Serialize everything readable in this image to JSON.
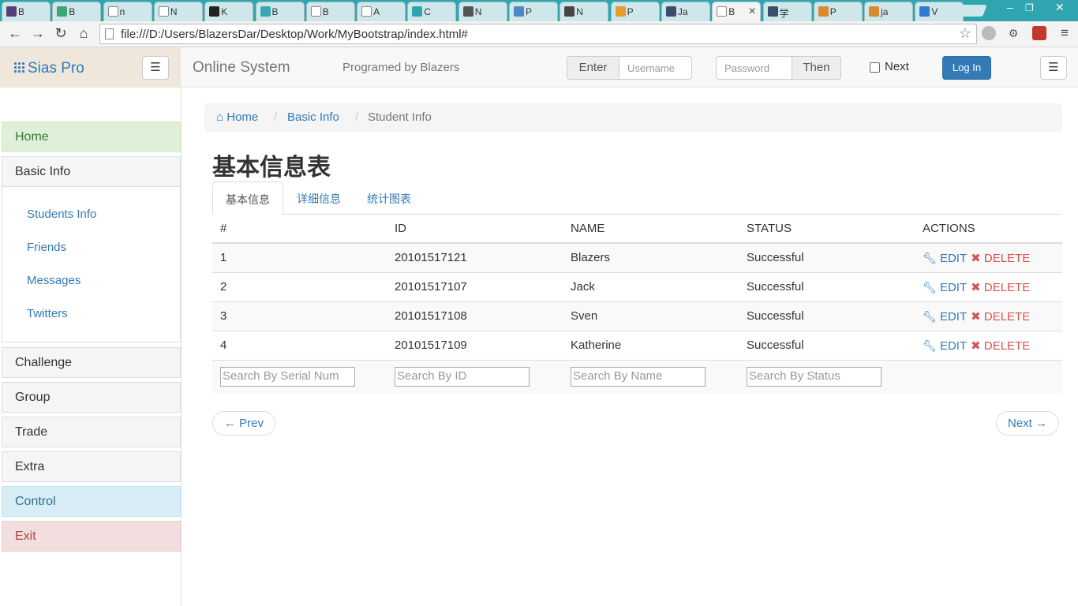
{
  "browser": {
    "tabs": [
      {
        "label": "B",
        "icon": "bootstrap-icon",
        "color": "#563d7c"
      },
      {
        "label": "B",
        "icon": "vue-icon",
        "color": "#3aa776"
      },
      {
        "label": "n",
        "icon": "page-icon",
        "color": ""
      },
      {
        "label": "N",
        "icon": "page-icon",
        "color": ""
      },
      {
        "label": "K",
        "icon": "k-icon",
        "color": "#222222"
      },
      {
        "label": "B",
        "icon": "bootstrap-icon",
        "color": "#3aa7b0"
      },
      {
        "label": "B",
        "icon": "page-icon",
        "color": ""
      },
      {
        "label": "A",
        "icon": "page-icon",
        "color": ""
      },
      {
        "label": "C",
        "icon": "chevron-icon",
        "color": "#2fa5b0"
      },
      {
        "label": "N",
        "icon": "photo-icon",
        "color": "#555555"
      },
      {
        "label": "P",
        "icon": "hexagon-icon",
        "color": "#4f86c6"
      },
      {
        "label": "N",
        "icon": "grid-icon",
        "color": "#444444"
      },
      {
        "label": "P",
        "icon": "shield-icon",
        "color": "#e89c2b"
      },
      {
        "label": "Ja",
        "icon": "bootstrap-icon",
        "color": "#3d4b6c"
      },
      {
        "label": "B",
        "icon": "page-icon",
        "color": "",
        "active": true
      },
      {
        "label": "学",
        "icon": "bootstrap-icon",
        "color": "#3d4b6c"
      },
      {
        "label": "P",
        "icon": "stack-icon",
        "color": "#d88a2e"
      },
      {
        "label": "ja",
        "icon": "stack-icon",
        "color": "#d88a2e"
      },
      {
        "label": "V",
        "icon": "code-icon",
        "color": "#2e7bcf"
      }
    ],
    "url": "file:///D:/Users/BlazersDar/Desktop/Work/MyBootstrap/index.html#"
  },
  "header": {
    "brand": "Sias Pro",
    "title": "Online System",
    "subtitle": "Programed by Blazers",
    "enter_label": "Enter",
    "username_placeholder": "Username",
    "password_placeholder": "Password",
    "then_label": "Then",
    "next_label": "Next",
    "login_label": "Log In"
  },
  "sidebar": {
    "items": [
      {
        "label": "Home",
        "style": "success"
      },
      {
        "label": "Basic Info",
        "style": "default"
      },
      {
        "label": "Challenge",
        "style": "default"
      },
      {
        "label": "Group",
        "style": "default"
      },
      {
        "label": "Trade",
        "style": "default"
      },
      {
        "label": "Extra",
        "style": "default"
      },
      {
        "label": "Control",
        "style": "info"
      },
      {
        "label": "Exit",
        "style": "danger"
      }
    ],
    "subitems": [
      "Students Info",
      "Friends",
      "Messages",
      "Twitters"
    ]
  },
  "breadcrumb": {
    "home": "Home",
    "basic": "Basic Info",
    "current": "Student Info",
    "sep": "/"
  },
  "main": {
    "title": "基本信息表",
    "tabs": [
      {
        "label": "基本信息",
        "active": true
      },
      {
        "label": "详细信息"
      },
      {
        "label": "统计图表"
      }
    ]
  },
  "table": {
    "headers": [
      "#",
      "ID",
      "NAME",
      "STATUS",
      "ACTIONS"
    ],
    "rows": [
      {
        "num": "1",
        "id": "20101517121",
        "name": "Blazers",
        "status": "Successful"
      },
      {
        "num": "2",
        "id": "20101517107",
        "name": "Jack",
        "status": "Successful"
      },
      {
        "num": "3",
        "id": "20101517108",
        "name": "Sven",
        "status": "Successful"
      },
      {
        "num": "4",
        "id": "20101517109",
        "name": "Katherine",
        "status": "Successful"
      }
    ],
    "edit_label": "EDIT",
    "delete_label": "DELETE",
    "search_placeholders": [
      "Search By Serial Num",
      "Search By ID",
      "Search By Name",
      "Search By Status"
    ]
  },
  "pager": {
    "prev": "← Prev",
    "next": "Next →"
  }
}
